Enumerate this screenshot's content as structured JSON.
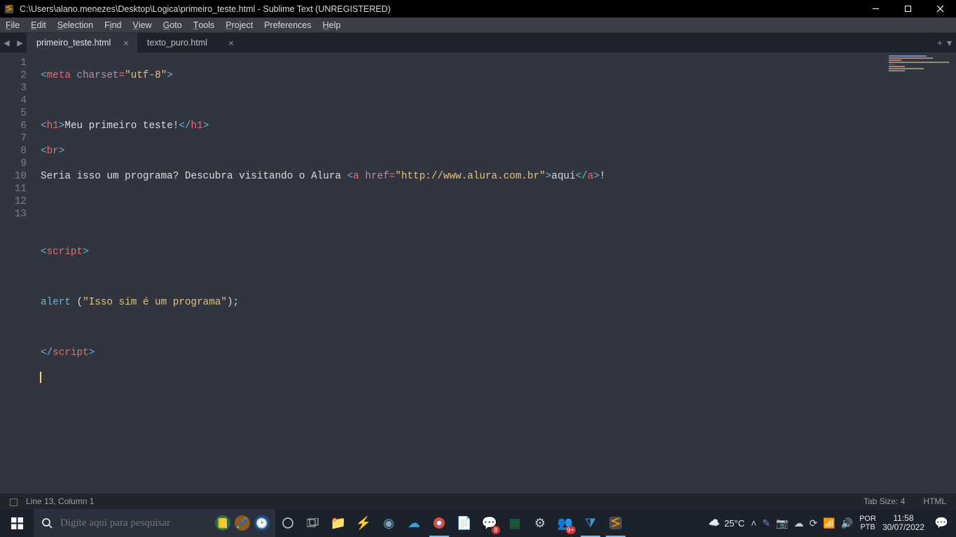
{
  "titlebar": {
    "title": "C:\\Users\\alano.menezes\\Desktop\\Logica\\primeiro_teste.html - Sublime Text (UNREGISTERED)"
  },
  "menu": {
    "items": [
      {
        "u": "F",
        "rest": "ile"
      },
      {
        "u": "E",
        "rest": "dit"
      },
      {
        "u": "S",
        "rest": "election"
      },
      {
        "u": "F",
        "rest": "ind",
        "pre": "",
        "label": "Find"
      },
      {
        "u": "V",
        "rest": "iew"
      },
      {
        "u": "G",
        "rest": "oto"
      },
      {
        "u": "T",
        "rest": "ools"
      },
      {
        "u": "P",
        "rest": "roject"
      },
      {
        "u": "",
        "rest": "Preferences"
      },
      {
        "u": "H",
        "rest": "elp"
      }
    ]
  },
  "tabs": [
    {
      "label": "primeiro_teste.html",
      "active": true
    },
    {
      "label": "texto_puro.html",
      "active": false
    }
  ],
  "gutterLines": [
    "1",
    "2",
    "3",
    "4",
    "5",
    "6",
    "7",
    "8",
    "9",
    "10",
    "11",
    "12",
    "13"
  ],
  "code": {
    "l1": {
      "tag": "meta",
      "attr": "charset",
      "val": "\"utf-8\""
    },
    "l3": {
      "open": "h1",
      "text": "Meu primeiro teste!",
      "close": "h1"
    },
    "l4": {
      "tag": "br"
    },
    "l5": {
      "pretext": "Seria isso um programa? Descubra visitando o Alura ",
      "atag": "a",
      "attr": "href",
      "val": "\"http://www.alura.com.br\"",
      "linktext": "aqui",
      "posttext": "!"
    },
    "l8": {
      "tag": "script"
    },
    "l10": {
      "fn": "alert",
      "arg": "\"Isso sim é um programa\"",
      "after": ";"
    },
    "l12": {
      "tag": "script"
    }
  },
  "statusbar": {
    "position": "Line 13, Column 1",
    "tabsize": "Tab Size: 4",
    "syntax": "HTML"
  },
  "taskbar": {
    "searchPlaceholder": "Digite aqui para pesquisar",
    "weather": "25°C",
    "lang1": "POR",
    "lang2": "PTB",
    "time": "11:58",
    "date": "30/07/2022",
    "badges": {
      "whatsapp": "8",
      "teams": "9+"
    }
  }
}
